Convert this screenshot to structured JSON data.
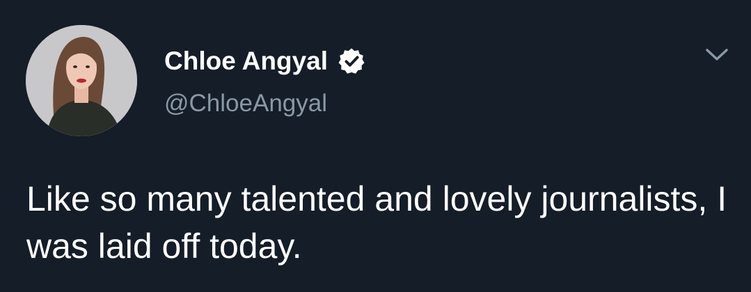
{
  "theme": {
    "background": "#151d28",
    "name_color": "#ffffff",
    "handle_color": "#8899a6",
    "text_color": "#ffffff",
    "verified_color": "#ffffff"
  },
  "author": {
    "display_name": "Chloe Angyal",
    "handle": "@ChloeAngyal",
    "verified": true,
    "avatar_icon": "profile-photo"
  },
  "menu": {
    "icon": "chevron-down-icon"
  },
  "tweet": {
    "text": "Like so many talented and lovely journalists, I was laid off today."
  }
}
